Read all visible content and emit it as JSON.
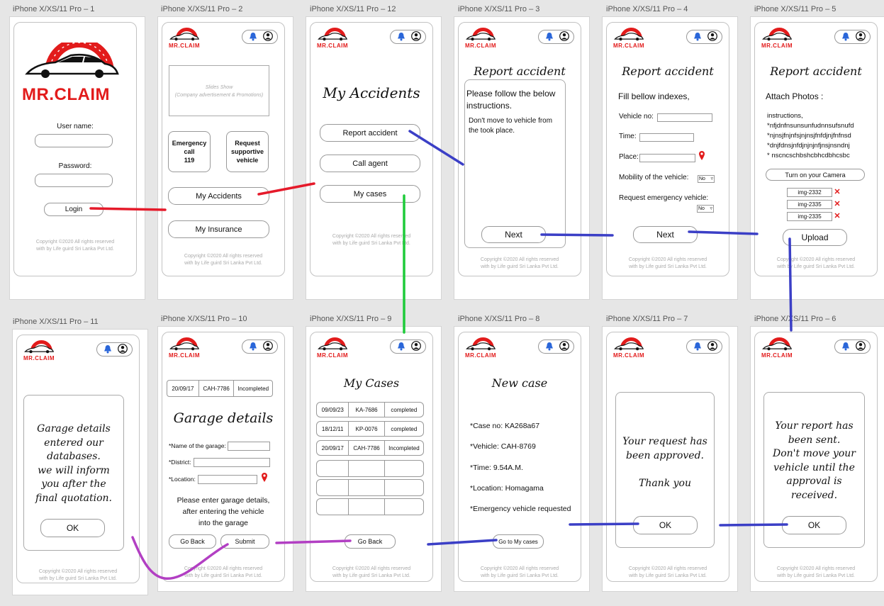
{
  "frame_labels": {
    "f1": "iPhone X/XS/11 Pro – 1",
    "f2": "iPhone X/XS/11 Pro – 2",
    "f12": "iPhone X/XS/11 Pro – 12",
    "f3": "iPhone X/XS/11 Pro – 3",
    "f4": "iPhone X/XS/11 Pro – 4",
    "f5": "iPhone X/XS/11 Pro – 5",
    "f11": "iPhone X/XS/11 Pro – 11",
    "f10": "iPhone X/XS/11 Pro – 10",
    "f9": "iPhone X/XS/11 Pro – 9",
    "f8": "iPhone X/XS/11 Pro – 8",
    "f7": "iPhone X/XS/11 Pro – 7",
    "f6": "iPhone X/XS/11 Pro – 6"
  },
  "brand": {
    "logo_text": "MR.CLAIM",
    "red": "#e21b1b"
  },
  "copyright": {
    "line1": "Copyright ©2020 All rights reserved",
    "line2": "with by Life guird Sri Lanka Pvt Ltd."
  },
  "screen1": {
    "username_label": "User name:",
    "password_label": "Password:",
    "login_button": "Login"
  },
  "screen2": {
    "slideshow_title": "Slides Show",
    "slideshow_sub": "(Company advertisement & Promotions)",
    "emergency_l1": "Emergency",
    "emergency_l2": "call",
    "emergency_l3": "119",
    "request_l1": "Request",
    "request_l2": "supportive",
    "request_l3": "vehicle",
    "my_accidents": "My Accidents",
    "my_insurance": "My Insurance"
  },
  "screen12": {
    "title": "My Accidents",
    "report_accident": "Report accident",
    "call_agent": "Call agent",
    "my_cases": "My cases"
  },
  "screen3": {
    "title": "Report accident",
    "instr1": "Please follow the below",
    "instr2": "instructions.",
    "note1": "Don't move to vehicle from",
    "note2": "the took place.",
    "next": "Next"
  },
  "screen4": {
    "title": "Report accident",
    "fill": "Fill bellow indexes,",
    "vehicle_no": "Vehicle no:",
    "time": "Time:",
    "place": "Place:",
    "mobility": "Mobility of the vehicle:",
    "mobility_value": "No",
    "request": "Request emergency vehicle:",
    "request_value": "No",
    "next": "Next"
  },
  "screen5": {
    "title": "Report accident",
    "attach": "Attach Photos :",
    "instr_head": "instructions,",
    "instr_lines": [
      "*nfjdnfnsunsunfudnnsufsnufd",
      "*njnsjfnjnfsjnjnsjfnfdjnjfnfnsd",
      "*dnjfdnsjnfdjnjnjnfjnsjnsndnj",
      "* nscncschbshcbhcdbhcsbc"
    ],
    "camera_button": "Turn on your Camera",
    "images": [
      "img-2332",
      "img-2335",
      "img-2335"
    ],
    "upload": "Upload"
  },
  "screen11": {
    "message": "Garage details\nentered our\ndatabases.\nwe will inform\nyou after the\nfinal quotation.",
    "ok": "OK"
  },
  "screen10": {
    "case_row": [
      "20/09/17",
      "CAH-7786",
      "Incompleted"
    ],
    "title": "Garage details",
    "name_label": "*Name of the garage:",
    "district_label": "*District:",
    "location_label": "*Location:",
    "note1": "Please enter garage details,",
    "note2": "after entering the vehicle",
    "note3": "into the garage",
    "go_back": "Go Back",
    "submit": "Submit"
  },
  "screen9": {
    "title": "My Cases",
    "rows": [
      [
        "09/09/23",
        "KA-7686",
        "completed"
      ],
      [
        "18/12/11",
        "KP-0076",
        "completed"
      ],
      [
        "20/09/17",
        "CAH-7786",
        "Incompleted"
      ],
      [
        "",
        "",
        ""
      ],
      [
        "",
        "",
        ""
      ],
      [
        "",
        "",
        ""
      ]
    ],
    "go_back": "Go Back"
  },
  "screen8": {
    "title": "New case",
    "case_no": "*Case no: KA268a67",
    "vehicle": "*Vehicle: CAH-8769",
    "time": "*Time: 9.54A.M.",
    "location": "*Location: Homagama",
    "emergency": "*Emergency vehicle requested",
    "go_to": "Go to My cases"
  },
  "screen7": {
    "message": "Your request has\nbeen approved.\n\nThank you",
    "ok": "OK"
  },
  "screen6": {
    "message": "Your report has\nbeen sent.\nDon't move your\nvehicle until the\napproval is\nreceived.",
    "ok": "OK"
  },
  "connector_colors": {
    "red": "#e51a2a",
    "blue": "#3b3fc6",
    "green": "#1ecb3a",
    "purple": "#b23fc3"
  }
}
